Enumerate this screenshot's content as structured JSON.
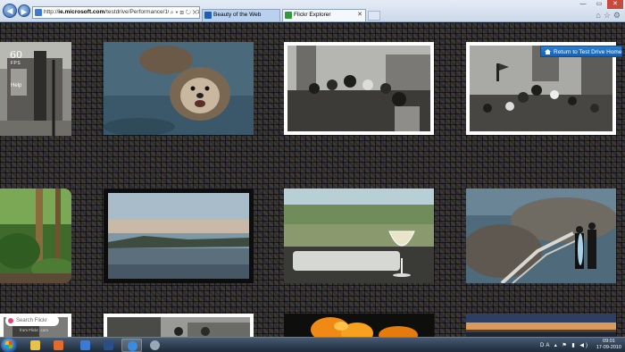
{
  "browser": {
    "address_host": "ie.microsoft.com",
    "address_rest": "/testdrive/Performance/10FlickrExplo",
    "address_prefix": "http://",
    "tabs": [
      {
        "label": "Beauty of the Web"
      },
      {
        "label": "Flickr Explorer"
      }
    ]
  },
  "page": {
    "fps_value": "60",
    "fps_label": "FPS",
    "help_label": "Help",
    "return_button": "Return to Test Drive Home",
    "search_placeholder": "Search Flickr",
    "credit": "from Flickr .com"
  },
  "photos": [
    {
      "name": "photo-sawmill-bw"
    },
    {
      "name": "photo-sea-otters"
    },
    {
      "name": "photo-crowd-bw-1"
    },
    {
      "name": "photo-crowd-bw-2"
    },
    {
      "name": "photo-forest"
    },
    {
      "name": "photo-bay-sunset"
    },
    {
      "name": "photo-wine-glass"
    },
    {
      "name": "photo-surfers-rocks"
    },
    {
      "name": "photo-bw-small"
    },
    {
      "name": "photo-street-bw"
    },
    {
      "name": "photo-orange-poppies"
    },
    {
      "name": "photo-sunset-horizon"
    }
  ],
  "taskbar": {
    "language": "DA",
    "time": "09:01",
    "date": "17-09-2010"
  },
  "colors": {
    "accent": "#1860b0",
    "page_background": "#2a2622"
  }
}
